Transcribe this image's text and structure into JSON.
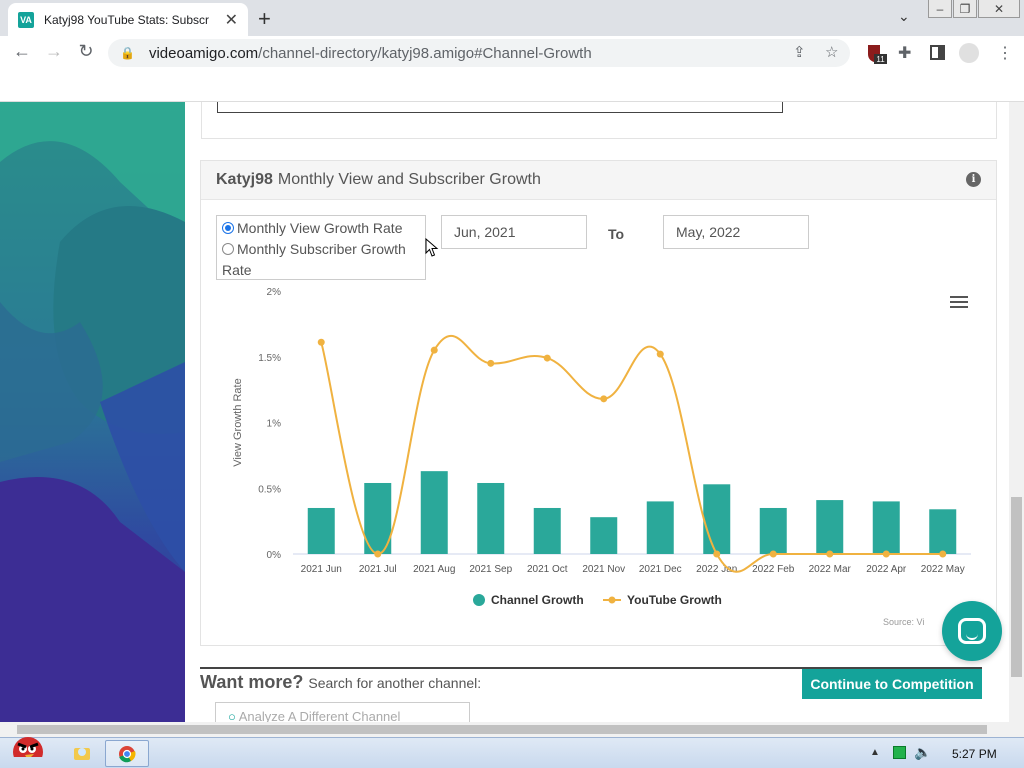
{
  "browser": {
    "tab_title": "Katyj98 YouTube Stats: Subscr",
    "favicon_text": "VA",
    "url_host": "videoamigo.com",
    "url_path": "/channel-directory/katyj98.amigo#Channel-Growth",
    "extension_badge": "11"
  },
  "card": {
    "title_bold": "Katyj98",
    "title_rest": "Monthly View and Subscriber Growth",
    "radio_option_1": "Monthly View Growth Rate",
    "radio_option_2": "Monthly Subscriber Growth Rate",
    "selected_option": "Monthly View Growth Rate",
    "date_from": "Jun, 2021",
    "to_label": "To",
    "date_to": "May, 2022",
    "source_label": "Source: Vi"
  },
  "chart_data": {
    "type": "bar",
    "ylabel": "View Growth Rate",
    "ylim": [
      0,
      2
    ],
    "yticks": [
      "0%",
      "0.5%",
      "1%",
      "1.5%",
      "2%"
    ],
    "categories": [
      "2021 Jun",
      "2021 Jul",
      "2021 Aug",
      "2021 Sep",
      "2021 Oct",
      "2021 Nov",
      "2021 Dec",
      "2022 Jan",
      "2022 Feb",
      "2022 Mar",
      "2022 Apr",
      "2022 May"
    ],
    "series": [
      {
        "name": "Channel Growth",
        "type": "bar",
        "color": "#2aa89a",
        "values": [
          0.35,
          0.54,
          0.63,
          0.54,
          0.35,
          0.28,
          0.4,
          0.53,
          0.35,
          0.41,
          0.4,
          0.34
        ]
      },
      {
        "name": "YouTube Growth",
        "type": "line",
        "color": "#f0b240",
        "values": [
          1.61,
          0.0,
          1.55,
          1.45,
          1.49,
          1.18,
          1.52,
          0.0,
          0.0,
          0.0,
          0.0,
          0.0
        ]
      }
    ],
    "legend": "bottom"
  },
  "more": {
    "title_bold": "Want more?",
    "title_rest": "Search for another channel:",
    "cta_label": "Continue to Competition",
    "search_placeholder": "Analyze A Different Channel"
  },
  "taskbar": {
    "clock": "5:27 PM"
  }
}
